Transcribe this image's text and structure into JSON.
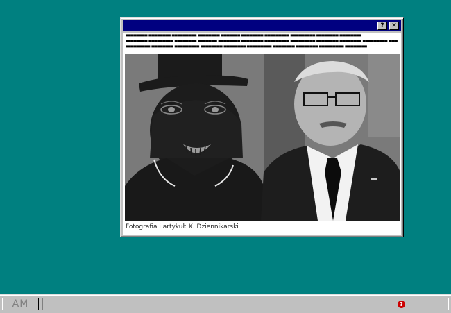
{
  "window": {
    "help_glyph": "?",
    "close_glyph": "✕",
    "article_lines": [
      "▀▀▀▀▀▀▀▀ ▀▀▀▀▀▀▀▀ ▀▀▀▀▀▀▀▀▀ ▀▀▀▀▀▀▀▀ ▀▀▀▀▀▀▀ ▀▀▀▀▀▀▀▀ ▀▀▀▀▀▀▀▀▀ ▀▀▀▀▀▀▀▀▀ ▀▀▀▀▀▀▀▀ ▀▀▀▀▀▀▀▀",
      "▀▀▀▀▀▀▀▀ ▀▀▀▀▀▀▀▀▀ ▀▀▀▀▀▀▀▀ ▀▀▀▀▀▀▀ ▀▀▀▀▀▀▀▀ ▀▀▀▀▀▀▀▀ ▀▀▀▀▀▀▀▀▀ ▀▀▀▀▀▀▀▀▀ ▀▀▀▀▀▀▀▀ ▀▀▀▀▀▀▀▀ ▀▀▀▀▀▀▀▀▀ ▀▀▀▀▀▀▀▀ ▀▀▀▀▀▀▀▀ ▀▀▀▀▀▀▀▀",
      "▀▀▀▀▀▀▀▀▀ ▀▀▀▀▀▀▀▀ ▀▀▀▀▀▀▀▀▀ ▀▀▀▀▀▀▀▀ ▀▀▀▀▀▀▀▀ ▀▀▀▀▀▀▀▀▀ ▀▀▀▀▀▀▀▀ ▀▀▀▀▀▀▀▀ ▀▀▀▀▀▀▀▀▀ ▀▀▀▀▀▀▀▀"
    ],
    "caption": "Fotografia i artykuł: K. Dziennikarski"
  },
  "taskbar": {
    "start_label": "AM",
    "tray_icon": "help-icon",
    "tray_glyph": "?"
  },
  "colors": {
    "desktop": "#008080",
    "title_bar": "#000080",
    "tray_icon": "#cc0000"
  }
}
